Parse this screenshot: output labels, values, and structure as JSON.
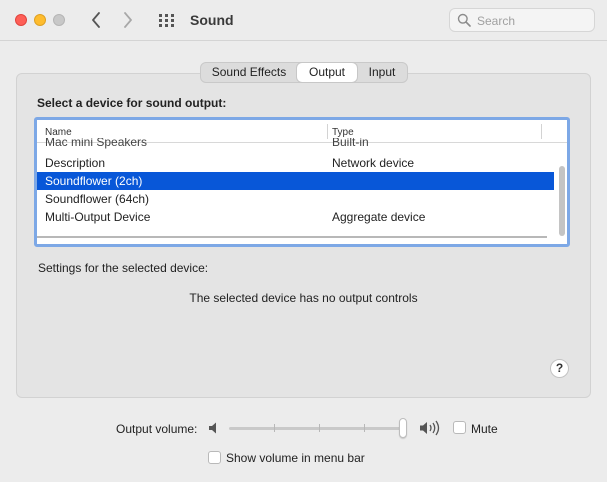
{
  "window": {
    "title": "Sound",
    "search_placeholder": "Search"
  },
  "tabs": [
    {
      "label": "Sound Effects",
      "selected": false
    },
    {
      "label": "Output",
      "selected": true
    },
    {
      "label": "Input",
      "selected": false
    }
  ],
  "output": {
    "section_label": "Select a device for sound output:",
    "columns": {
      "name": "Name",
      "type": "Type"
    },
    "partial_top_row": {
      "name": "Mac mini Speakers",
      "type": "Built-in"
    },
    "devices": [
      {
        "name": "Description",
        "type": "Network device",
        "selected": false
      },
      {
        "name": "Soundflower (2ch)",
        "type": "",
        "selected": true
      },
      {
        "name": "Soundflower (64ch)",
        "type": "",
        "selected": false
      },
      {
        "name": "Multi-Output Device",
        "type": "Aggregate device",
        "selected": false
      }
    ],
    "settings_label": "Settings for the selected device:",
    "no_controls_text": "The selected device has no output controls",
    "help_label": "?"
  },
  "volume": {
    "label": "Output volume:",
    "level": 1.0,
    "mute_label": "Mute",
    "mute_checked": false,
    "show_in_menubar_label": "Show volume in menu bar",
    "show_in_menubar_checked": false
  },
  "icons": {
    "back": "chevron-left-icon",
    "forward": "chevron-right-icon",
    "grid": "grid-icon",
    "search": "search-icon",
    "volume_low": "speaker-low-icon",
    "volume_high": "speaker-high-icon"
  },
  "colors": {
    "selection": "#0857d8",
    "focus_ring": "#7da8e6",
    "close": "#fe5f57",
    "minimize": "#febc2e"
  }
}
